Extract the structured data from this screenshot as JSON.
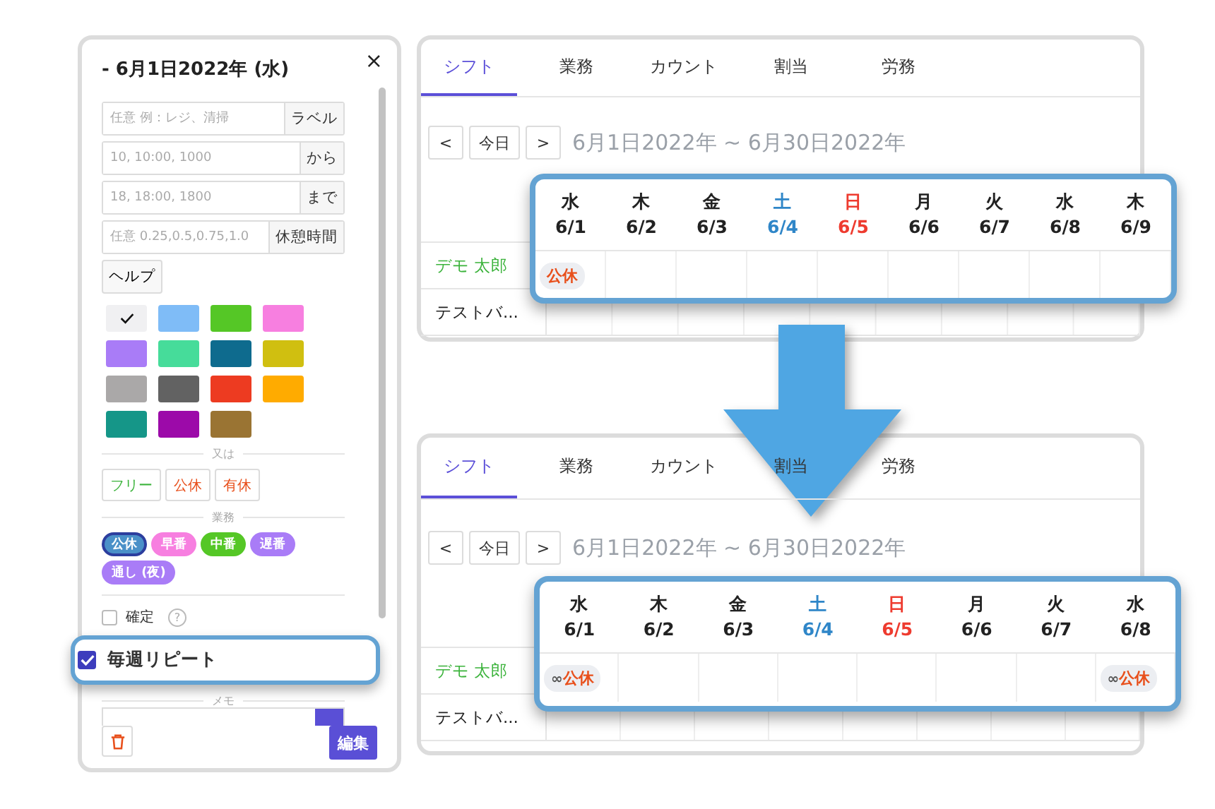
{
  "editor": {
    "title": "- 6月1日2022年 (水)",
    "close": "×",
    "fields": [
      {
        "placeholder": "任意 例：レジ、清掃",
        "addon": "ラベル"
      },
      {
        "placeholder": "10, 10:00, 1000",
        "addon": "から"
      },
      {
        "placeholder": "18, 18:00, 1800",
        "addon": "まで"
      },
      {
        "placeholder": "任意 0.25,0.5,0.75,1.0",
        "addon": "休憩時間"
      }
    ],
    "help": "ヘルプ",
    "colors": [
      {
        "color": "#f0f0f2",
        "selected": true
      },
      {
        "color": "#7fbcf7",
        "selected": false
      },
      {
        "color": "#55c726",
        "selected": false
      },
      {
        "color": "#f77fe0",
        "selected": false
      },
      {
        "color": "#a97cf7",
        "selected": false
      },
      {
        "color": "#46dc9a",
        "selected": false
      },
      {
        "color": "#0e6b8e",
        "selected": false
      },
      {
        "color": "#d0bf10",
        "selected": false
      },
      {
        "color": "#aaa8a8",
        "selected": false
      },
      {
        "color": "#626262",
        "selected": false
      },
      {
        "color": "#ed3b21",
        "selected": false
      },
      {
        "color": "#ffab00",
        "selected": false
      },
      {
        "color": "#159688",
        "selected": false
      },
      {
        "color": "#9c0aa9",
        "selected": false
      },
      {
        "color": "#9a7433",
        "selected": false
      }
    ],
    "or_divider": "又は",
    "quick": [
      {
        "label": "フリー",
        "color": "#3cb33c"
      },
      {
        "label": "公休",
        "color": "#e8501c"
      },
      {
        "label": "有休",
        "color": "#e8501c"
      }
    ],
    "tasks_divider": "業務",
    "tasks": [
      {
        "label": "公休",
        "color": "#4a90c8",
        "selected": true
      },
      {
        "label": "早番",
        "color": "#f77fe0",
        "selected": false
      },
      {
        "label": "中番",
        "color": "#55c726",
        "selected": false
      },
      {
        "label": "遅番",
        "color": "#a97cf7",
        "selected": false
      },
      {
        "label": "通し (夜)",
        "color": "#a97cf7",
        "selected": false
      }
    ],
    "confirm": {
      "label": "確定",
      "checked": false,
      "help": "?"
    },
    "repeat": {
      "label": "毎週リピート",
      "checked": true
    },
    "memo_divider": "メモ",
    "save": "編集"
  },
  "panels": [
    {
      "tabs": [
        {
          "label": "シフト",
          "selected": true
        },
        {
          "label": "業務",
          "selected": false
        },
        {
          "label": "カウント",
          "selected": false
        },
        {
          "label": "割当",
          "selected": false
        },
        {
          "label": "労務",
          "selected": false
        }
      ],
      "prev": "<",
      "today": "今日",
      "next": ">",
      "range": "6月1日2022年 ~ 6月30日2022年",
      "days": [
        {
          "weekday": "水",
          "date": "6/1",
          "kind": "weekday"
        },
        {
          "weekday": "木",
          "date": "6/2",
          "kind": "weekday"
        },
        {
          "weekday": "金",
          "date": "6/3",
          "kind": "weekday"
        },
        {
          "weekday": "土",
          "date": "6/4",
          "kind": "saturday"
        },
        {
          "weekday": "日",
          "date": "6/5",
          "kind": "sunday"
        },
        {
          "weekday": "月",
          "date": "6/6",
          "kind": "weekday"
        },
        {
          "weekday": "火",
          "date": "6/7",
          "kind": "weekday"
        },
        {
          "weekday": "水",
          "date": "6/8",
          "kind": "weekday"
        },
        {
          "weekday": "木",
          "date": "6/9",
          "kind": "weekday"
        }
      ],
      "rows": [
        {
          "name": "デモ 太郎",
          "color": "#3cb33c",
          "cells": [
            {
              "chip": "公休"
            },
            {},
            {},
            {},
            {},
            {},
            {},
            {},
            {}
          ]
        },
        {
          "name": "テストバ...",
          "color": "#222222"
        }
      ]
    },
    {
      "tabs": [
        {
          "label": "シフト",
          "selected": true
        },
        {
          "label": "業務",
          "selected": false
        },
        {
          "label": "カウント",
          "selected": false
        },
        {
          "label": "割当",
          "selected": false
        },
        {
          "label": "労務",
          "selected": false
        }
      ],
      "prev": "<",
      "today": "今日",
      "next": ">",
      "range": "6月1日2022年 ~ 6月30日2022年",
      "days": [
        {
          "weekday": "水",
          "date": "6/1",
          "kind": "weekday"
        },
        {
          "weekday": "木",
          "date": "6/2",
          "kind": "weekday"
        },
        {
          "weekday": "金",
          "date": "6/3",
          "kind": "weekday"
        },
        {
          "weekday": "土",
          "date": "6/4",
          "kind": "saturday"
        },
        {
          "weekday": "日",
          "date": "6/5",
          "kind": "sunday"
        },
        {
          "weekday": "月",
          "date": "6/6",
          "kind": "weekday"
        },
        {
          "weekday": "火",
          "date": "6/7",
          "kind": "weekday"
        },
        {
          "weekday": "水",
          "date": "6/8",
          "kind": "weekday"
        }
      ],
      "rows": [
        {
          "name": "デモ 太郎",
          "color": "#3cb33c",
          "cells": [
            {
              "chip": "公休",
              "repeat_mark": "∞"
            },
            {},
            {},
            {},
            {},
            {},
            {},
            {
              "chip": "公休",
              "repeat_mark": "∞"
            }
          ]
        },
        {
          "name": "テストバ...",
          "color": "#222222"
        }
      ]
    }
  ]
}
